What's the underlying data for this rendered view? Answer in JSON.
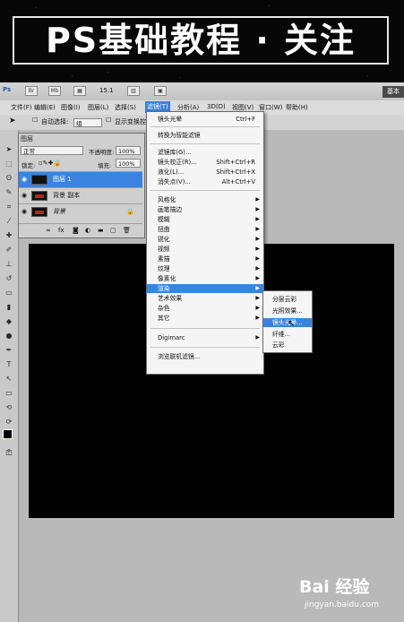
{
  "banner": {
    "title": "PS基础教程 · 关注"
  },
  "app": {
    "logo": "Ps",
    "zoom": "15.1",
    "workspace_label": "基本"
  },
  "menubar": [
    "文件(F)",
    "编辑(E)",
    "图像(I)",
    "图层(L)",
    "选择(S)",
    "滤镜(T)",
    "分析(A)",
    "3D(D)",
    "视图(V)",
    "窗口(W)",
    "帮助(H)"
  ],
  "options": {
    "auto_select": "自动选择:",
    "auto_select_value": "组",
    "show_transform": "显示变换控件"
  },
  "layers_panel": {
    "tab": "图层",
    "blend_mode": "正常",
    "opacity_label": "不透明度:",
    "opacity_value": "100%",
    "lock_label": "锁定:",
    "fill_label": "填充:",
    "fill_value": "100%",
    "layers": [
      {
        "name": "图层 1",
        "selected": true
      },
      {
        "name": "背景 副本",
        "selected": false
      },
      {
        "name": "背景",
        "selected": false
      }
    ],
    "footer_icons": [
      "link-icon",
      "fx-icon",
      "mask-icon",
      "adjust-icon",
      "folder-icon",
      "new-layer-icon",
      "trash-icon"
    ]
  },
  "filter_menu": {
    "items": [
      {
        "label": "镜头光晕",
        "shortcut": "Ctrl+F"
      },
      {
        "label": "转换为智能滤镜",
        "shortcut": ""
      },
      {
        "label": "滤镜库(G)...",
        "shortcut": ""
      },
      {
        "label": "镜头校正(R)...",
        "shortcut": "Shift+Ctrl+R"
      },
      {
        "label": "液化(L)...",
        "shortcut": "Shift+Ctrl+X"
      },
      {
        "label": "消失点(V)...",
        "shortcut": "Alt+Ctrl+V"
      },
      {
        "label": "风格化",
        "submenu": true
      },
      {
        "label": "画笔描边",
        "submenu": true
      },
      {
        "label": "模糊",
        "submenu": true
      },
      {
        "label": "扭曲",
        "submenu": true
      },
      {
        "label": "锐化",
        "submenu": true
      },
      {
        "label": "视频",
        "submenu": true
      },
      {
        "label": "素描",
        "submenu": true
      },
      {
        "label": "纹理",
        "submenu": true
      },
      {
        "label": "像素化",
        "submenu": true
      },
      {
        "label": "渲染",
        "submenu": true,
        "highlighted": true
      },
      {
        "label": "艺术效果",
        "submenu": true
      },
      {
        "label": "杂色",
        "submenu": true
      },
      {
        "label": "其它",
        "submenu": true
      },
      {
        "label": "Digimarc",
        "submenu": true
      },
      {
        "label": "浏览联机滤镜...",
        "shortcut": ""
      }
    ]
  },
  "render_submenu": {
    "items": [
      {
        "label": "分层云彩",
        "highlighted": false
      },
      {
        "label": "光照效果...",
        "highlighted": false
      },
      {
        "label": "镜头光晕...",
        "highlighted": true
      },
      {
        "label": "纤维...",
        "highlighted": false
      },
      {
        "label": "云彩",
        "highlighted": false
      }
    ]
  },
  "watermark": {
    "brand": "Bai 经验",
    "url": "jingyan.baidu.com"
  },
  "colors": {
    "highlight": "#3a84e0",
    "canvas": "#000000",
    "banner_bg": "#070707"
  }
}
